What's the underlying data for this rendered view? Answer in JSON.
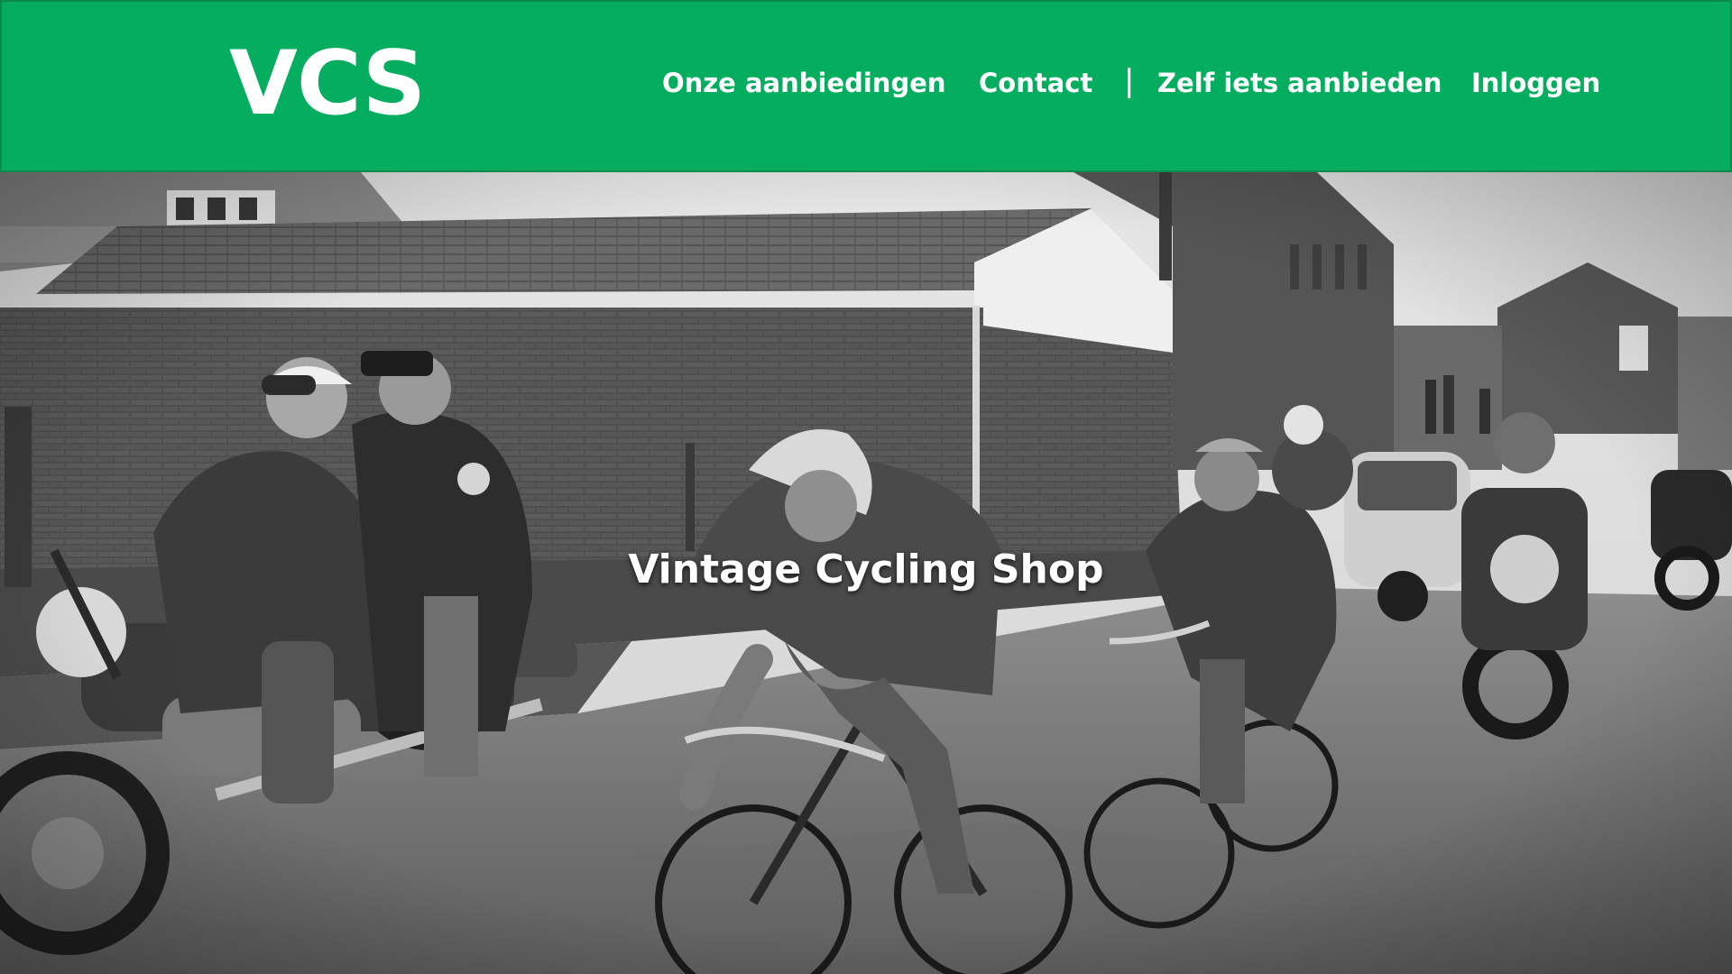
{
  "header": {
    "logo_text": "VCS",
    "background_color": "#05ae5f",
    "nav": {
      "items": [
        {
          "label": "Onze aanbiedingen"
        },
        {
          "label": "Contact"
        },
        {
          "label": "Zelf iets aanbieden"
        },
        {
          "label": "Inloggen"
        }
      ],
      "separator": "|"
    }
  },
  "hero": {
    "title": "Vintage Cycling Shop",
    "image": {
      "style": "black-and-white photograph",
      "subject": "vintage road cyclists racing on a village road followed by motorcycles and a car"
    }
  }
}
